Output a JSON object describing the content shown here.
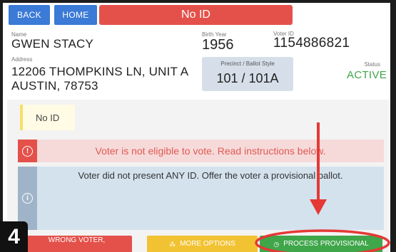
{
  "nav": {
    "back_label": "BACK",
    "home_label": "HOME",
    "banner_text": "No ID"
  },
  "voter": {
    "name_label": "Name",
    "name": "GWEN STACY",
    "birth_year_label": "Birth Year",
    "birth_year": "1956",
    "voter_id_label": "Voter ID",
    "voter_id": "1154886821",
    "address_label": "Address",
    "address_line1": "12206 THOMPKINS LN, UNIT A",
    "address_line2": "AUSTIN, 78753",
    "precinct_label": "Precinct / Ballot Style",
    "precinct": "101 / 101A",
    "status_label": "Status",
    "status": "ACTIVE"
  },
  "content": {
    "id_card_text": "No ID",
    "error_text": "Voter is not eligible to vote.  Read instructions below.",
    "info_text": "Voter did not present ANY ID. Offer the voter a provisional ballot."
  },
  "actions": {
    "wrong_voter_label": "WRONG VOTER,",
    "more_options_label": "MORE OPTIONS",
    "process_provisional_label": "PROCESS PROVISIONAL"
  },
  "step": {
    "number": "4"
  },
  "colors": {
    "nav_blue": "#3b7ad6",
    "alert_red": "#e4514a",
    "status_green": "#3fa64a",
    "option_yellow": "#f1c232",
    "info_blue": "#d4e2ee",
    "annotation_red": "#e53935"
  },
  "icons": {
    "error": "exclamation-circle-icon",
    "info": "info-circle-icon",
    "arrow": "down-arrow-annotation",
    "ellipse": "highlight-ellipse-annotation"
  }
}
